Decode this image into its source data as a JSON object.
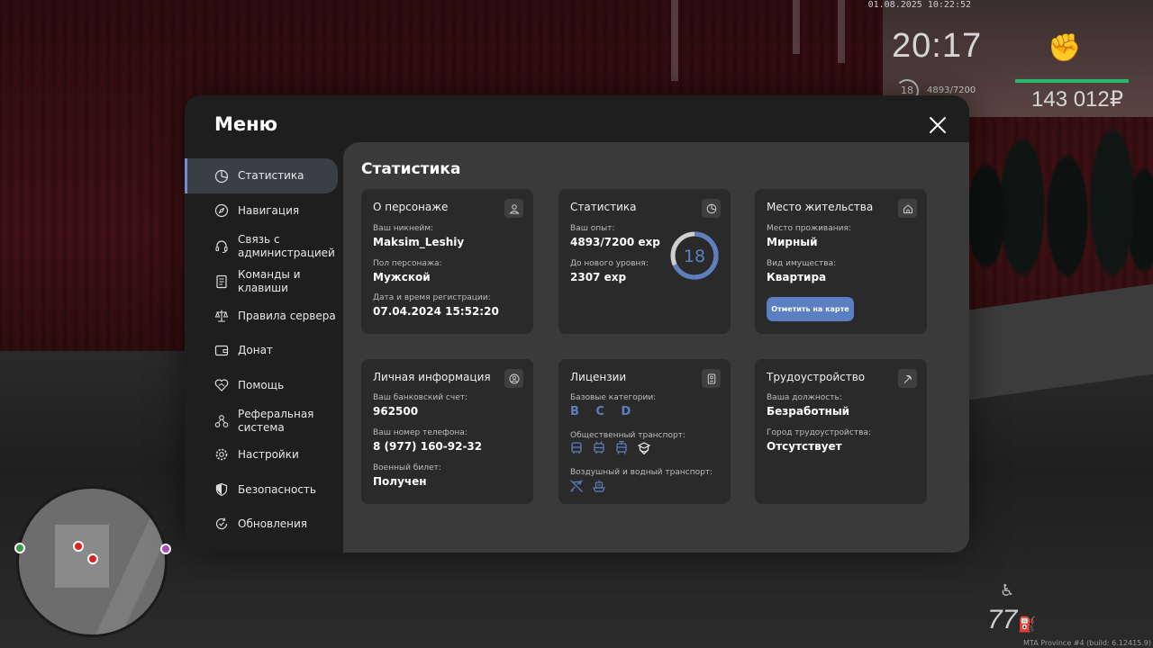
{
  "hud": {
    "datetime": "01.08.2025 10:22:52",
    "time": "20:17",
    "level": "18",
    "exp": "4893/7200",
    "money": "143 012₽",
    "speed": "77",
    "build": "MTA Province #4 (build: 6.12415.9)"
  },
  "menu": {
    "title": "Меню",
    "sidebar": [
      {
        "label": "Статистика",
        "icon": "pie-chart-icon",
        "active": true
      },
      {
        "label": "Навигация",
        "icon": "compass-icon"
      },
      {
        "label": "Связь с администрацией",
        "icon": "headset-icon"
      },
      {
        "label": "Команды и клавиши",
        "icon": "document-icon"
      },
      {
        "label": "Правила сервера",
        "icon": "scales-icon"
      },
      {
        "label": "Донат",
        "icon": "wallet-icon"
      },
      {
        "label": "Помощь",
        "icon": "handshake-heart-icon"
      },
      {
        "label": "Реферальная система",
        "icon": "network-icon"
      },
      {
        "label": "Настройки",
        "icon": "gear-icon"
      },
      {
        "label": "Безопасность",
        "icon": "shield-icon"
      },
      {
        "label": "Обновления",
        "icon": "refresh-check-icon"
      }
    ],
    "content_title": "Статистика",
    "cards": {
      "character": {
        "title": "О персонаже",
        "nickname_label": "Ваш никнейм:",
        "nickname": "Maksim_Leshiy",
        "gender_label": "Пол персонажа:",
        "gender": "Мужской",
        "reg_label": "Дата и время регистрации:",
        "reg_date": "07.04.2024 15:52:20"
      },
      "stats": {
        "title": "Статистика",
        "exp_label": "Ваш опыт:",
        "exp": "4893/7200 exp",
        "next_label": "До нового уровня:",
        "next": "2307 exp",
        "level": "18",
        "progress": 0.68
      },
      "residence": {
        "title": "Место жительства",
        "place_label": "Место проживания:",
        "place": "Мирный",
        "property_label": "Вид имущества:",
        "property": "Квартира",
        "button": "Отметить на карте"
      },
      "personal": {
        "title": "Личная информация",
        "bank_label": "Ваш банковский счет:",
        "bank": "962500",
        "phone_label": "Ваш номер телефона:",
        "phone": "8 (977) 160-92-32",
        "military_label": "Военный билет:",
        "military": "Получен"
      },
      "licenses": {
        "title": "Лицензии",
        "base_label": "Базовые категории:",
        "base": "B C D",
        "public_label": "Общественный транспорт:",
        "air_label": "Воздушный и водный транспорт:"
      },
      "employment": {
        "title": "Трудоустройство",
        "position_label": "Ваша должность:",
        "position": "Безработный",
        "city_label": "Город трудоустройства:",
        "city": "Отсутствует"
      }
    }
  },
  "colors": {
    "accent": "#5b7fc0",
    "hp": "#2bb56f"
  }
}
